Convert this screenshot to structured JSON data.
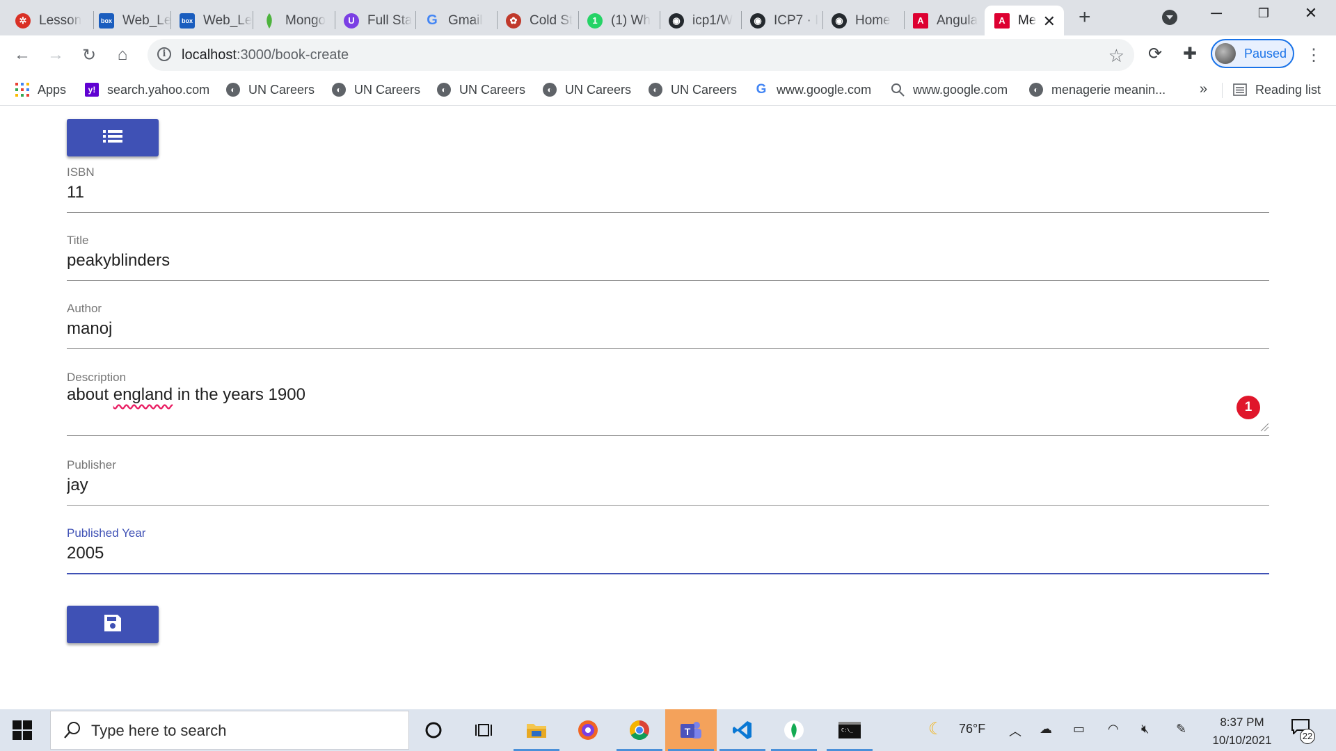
{
  "browser": {
    "tabs": [
      {
        "label": "Lesson",
        "icon": "lesson-icon",
        "color": "#d93025"
      },
      {
        "label": "Web_Le",
        "icon": "box-icon",
        "color": "#1a5dbe"
      },
      {
        "label": "Web_Le",
        "icon": "box-icon",
        "color": "#1a5dbe"
      },
      {
        "label": "Mongo",
        "icon": "mongodb-leaf-icon",
        "color": "#4db33d"
      },
      {
        "label": "Full Sta",
        "icon": "udemy-icon",
        "color": "#7b3fe4"
      },
      {
        "label": "Gmail",
        "icon": "google-icon",
        "color": "#4285f4"
      },
      {
        "label": "Cold St",
        "icon": "coldstone-icon",
        "color": "#c0392b"
      },
      {
        "label": "(1) Wh",
        "icon": "whatsapp-icon",
        "color": "#25d366"
      },
      {
        "label": "icp1/W",
        "icon": "github-icon",
        "color": "#24292e"
      },
      {
        "label": "ICP7 · I",
        "icon": "github-icon",
        "color": "#24292e"
      },
      {
        "label": "Home",
        "icon": "github-icon",
        "color": "#24292e"
      },
      {
        "label": "Angula",
        "icon": "angular-icon",
        "color": "#dd0031"
      },
      {
        "label": "Me",
        "icon": "angular-icon",
        "color": "#dd0031",
        "active": true
      }
    ],
    "new_tab": "+",
    "address": {
      "host": "localhost",
      "path": ":3000/book-create"
    },
    "profile_label": "Paused",
    "bookmarks": [
      {
        "label": "Apps",
        "icon": "apps-grid-icon"
      },
      {
        "label": "search.yahoo.com",
        "icon": "yahoo-icon"
      },
      {
        "label": "UN Careers",
        "icon": "globe-icon"
      },
      {
        "label": "UN Careers",
        "icon": "globe-icon"
      },
      {
        "label": "UN Careers",
        "icon": "globe-icon"
      },
      {
        "label": "UN Careers",
        "icon": "globe-icon"
      },
      {
        "label": "UN Careers",
        "icon": "globe-icon"
      },
      {
        "label": "www.google.com",
        "icon": "google-icon"
      },
      {
        "label": "www.google.com",
        "icon": "search-icon"
      },
      {
        "label": "menagerie meanin...",
        "icon": "globe-icon"
      }
    ],
    "bookmarks_more": "»",
    "reading_list": "Reading list"
  },
  "form": {
    "list_button_icon": "list-icon",
    "save_button_icon": "save-icon",
    "fields": {
      "isbn": {
        "label": "ISBN",
        "value": "11"
      },
      "title": {
        "label": "Title",
        "value": "peakyblinders"
      },
      "author": {
        "label": "Author",
        "value": "manoj"
      },
      "description": {
        "label": "Description",
        "value_pre": "about ",
        "value_misspelled": "england",
        "value_post": " in the years 1900",
        "badge": "1"
      },
      "publisher": {
        "label": "Publisher",
        "value": "jay"
      },
      "published_year": {
        "label": "Published Year",
        "value": "2005",
        "focused": true
      }
    },
    "accent_color": "#3f51b5"
  },
  "taskbar": {
    "search_placeholder": "Type here to search",
    "weather": "76°F",
    "time": "8:37 PM",
    "date": "10/10/2021",
    "notification_count": "22"
  }
}
